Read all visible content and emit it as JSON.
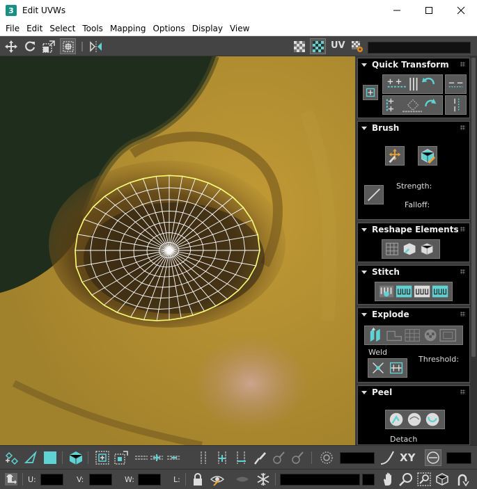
{
  "window": {
    "app_icon_text": "3",
    "title": "Edit UVWs"
  },
  "menu": [
    "File",
    "Edit",
    "Select",
    "Tools",
    "Mapping",
    "Options",
    "Display",
    "View"
  ],
  "toolbar": {
    "uv_label": "UV"
  },
  "panel": {
    "quick_transform": {
      "title": "Quick Transform"
    },
    "brush": {
      "title": "Brush",
      "strength_label": "Strength:",
      "falloff_label": "Falloff:"
    },
    "reshape": {
      "title": "Reshape Elements"
    },
    "stitch": {
      "title": "Stitch"
    },
    "explode": {
      "title": "Explode",
      "weld_label": "Weld",
      "threshold_label": "Threshold:"
    },
    "peel": {
      "title": "Peel",
      "detach_label": "Detach"
    }
  },
  "status": {
    "u_label": "U:",
    "v_label": "V:",
    "w_label": "W:",
    "l_label": "L:",
    "xy_label": "XY"
  },
  "colors": {
    "accent": "#5fd3d3",
    "panel_bg": "#000000",
    "chrome_bg": "#444444",
    "mesh": "#ffffff",
    "mesh_outline": "#ffff7a"
  }
}
